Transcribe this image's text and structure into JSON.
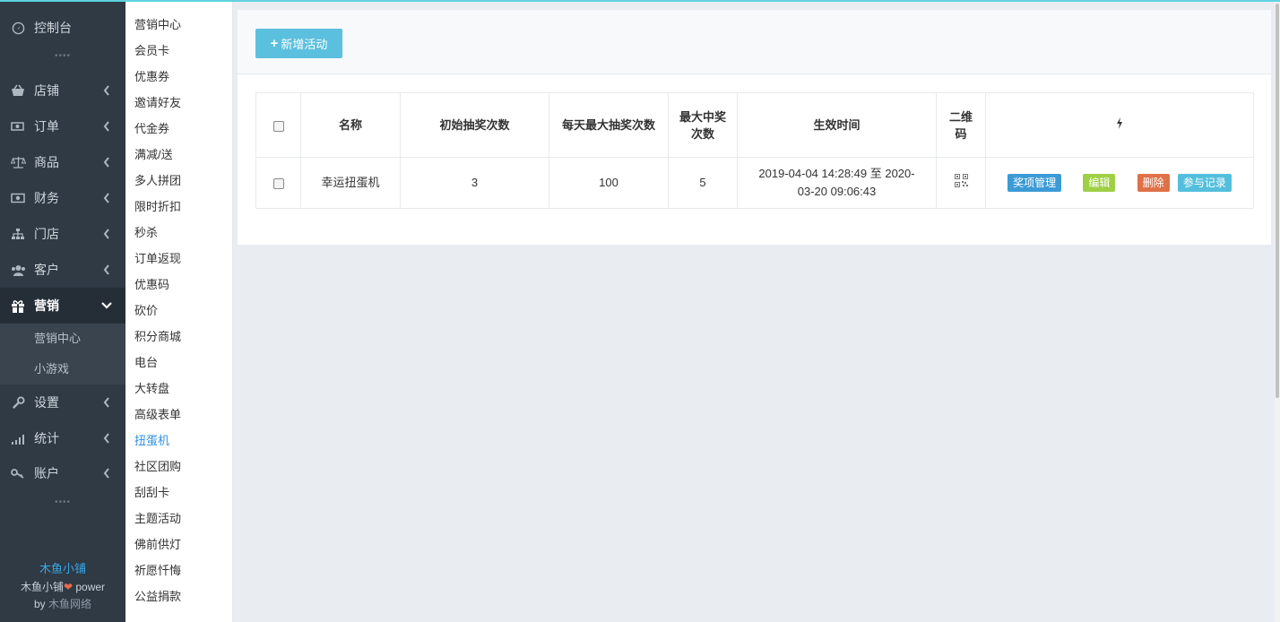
{
  "sidebar": {
    "items": [
      {
        "label": "控制台",
        "icon": "dashboard-icon",
        "arrow": ""
      },
      {
        "label": "店铺",
        "icon": "basket-icon",
        "arrow": "chevron-left-icon"
      },
      {
        "label": "订单",
        "icon": "money-icon",
        "arrow": "chevron-left-icon"
      },
      {
        "label": "商品",
        "icon": "scale-icon",
        "arrow": "chevron-left-icon"
      },
      {
        "label": "财务",
        "icon": "cash-icon",
        "arrow": "chevron-left-icon"
      },
      {
        "label": "门店",
        "icon": "sitemap-icon",
        "arrow": "chevron-left-icon"
      },
      {
        "label": "客户",
        "icon": "users-icon",
        "arrow": "chevron-left-icon"
      },
      {
        "label": "营销",
        "icon": "gift-icon",
        "arrow": "chevron-down-icon"
      },
      {
        "label": "设置",
        "icon": "wrench-icon",
        "arrow": "chevron-left-icon"
      },
      {
        "label": "统计",
        "icon": "signal-icon",
        "arrow": "chevron-left-icon"
      },
      {
        "label": "账户",
        "icon": "key-icon",
        "arrow": "chevron-left-icon"
      }
    ],
    "dots": "••••",
    "sub_items": [
      "营销中心",
      "小游戏"
    ],
    "brand": {
      "name": "木鱼小铺",
      "line2_a": "木鱼小铺",
      "line2_b": " power",
      "line3_a": "by ",
      "line3_b": "木鱼网络"
    }
  },
  "submenu": [
    "营销中心",
    "会员卡",
    "优惠券",
    "邀请好友",
    "代金券",
    "满减/送",
    "多人拼团",
    "限时折扣",
    "秒杀",
    "订单返现",
    "优惠码",
    "砍价",
    "积分商城",
    "电台",
    "大转盘",
    "高级表单",
    "扭蛋机",
    "社区团购",
    "刮刮卡",
    "主题活动",
    "佛前供灯",
    "祈愿忏悔",
    "公益捐款"
  ],
  "toolbar": {
    "add_label": "新增活动"
  },
  "table": {
    "headers": {
      "name": "名称",
      "init": "初始抽奖次数",
      "daily": "每天最大抽奖次数",
      "max_a": "最大中奖",
      "max_b": "次数",
      "time": "生效时间",
      "qr_a": "二维",
      "qr_b": "码"
    },
    "rows": [
      {
        "name": "幸运扭蛋机",
        "init": "3",
        "daily": "100",
        "max": "5",
        "time_a": "2019-04-04 14:28:49 至 2020-",
        "time_b": "03-20 09:06:43"
      }
    ],
    "actions": {
      "prizes": "奖项管理",
      "edit": "编辑",
      "delete": "删除",
      "records": "参与记录"
    }
  },
  "colors": {
    "accent": "#5bc0de",
    "link": "#2f8fe0",
    "sidebar_bg": "#2f3a45"
  }
}
